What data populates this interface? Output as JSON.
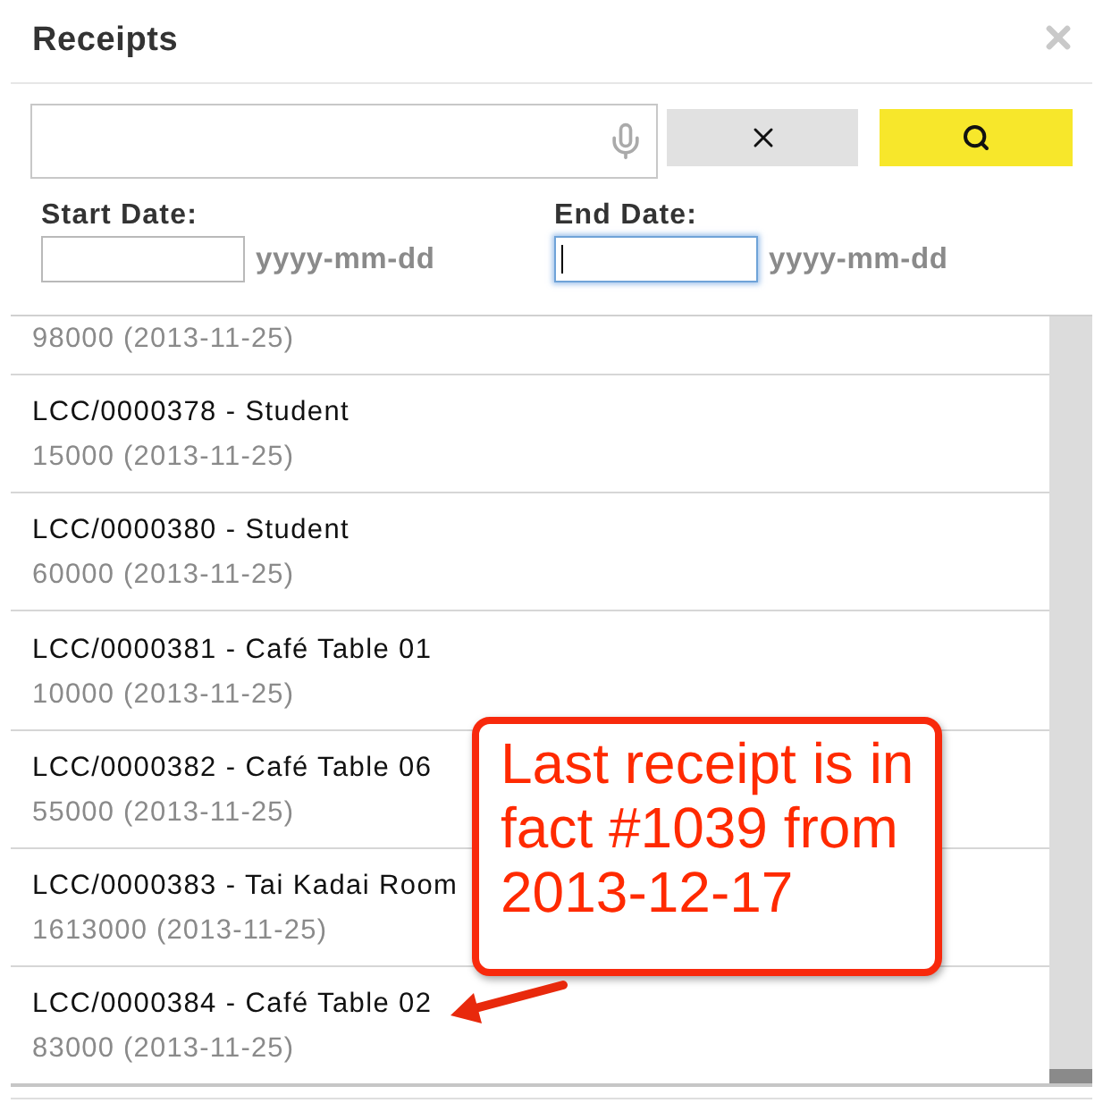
{
  "dialog": {
    "title": "Receipts"
  },
  "date_filters": [
    {
      "label": "Start Date:",
      "hint": "yyyy-mm-dd",
      "focused": false
    },
    {
      "label": "End Date:",
      "hint": "yyyy-mm-dd",
      "focused": true
    }
  ],
  "receipts": [
    {
      "detail": "98000 (2013-11-25)"
    },
    {
      "title": "LCC/0000378 - Student",
      "detail": "15000 (2013-11-25)"
    },
    {
      "title": "LCC/0000380 - Student",
      "detail": "60000 (2013-11-25)"
    },
    {
      "title": "LCC/0000381 - Café Table 01",
      "detail": "10000 (2013-11-25)"
    },
    {
      "title": "LCC/0000382 - Café Table 06",
      "detail": "55000 (2013-11-25)"
    },
    {
      "title": "LCC/0000383 - Tai Kadai Room",
      "detail": "1613000 (2013-11-25)"
    },
    {
      "title": "LCC/0000384 - Café Table 02",
      "detail": "83000 (2013-11-25)"
    }
  ],
  "annotation": {
    "text": "Last receipt is in fact #1039 from 2013-12-17"
  }
}
